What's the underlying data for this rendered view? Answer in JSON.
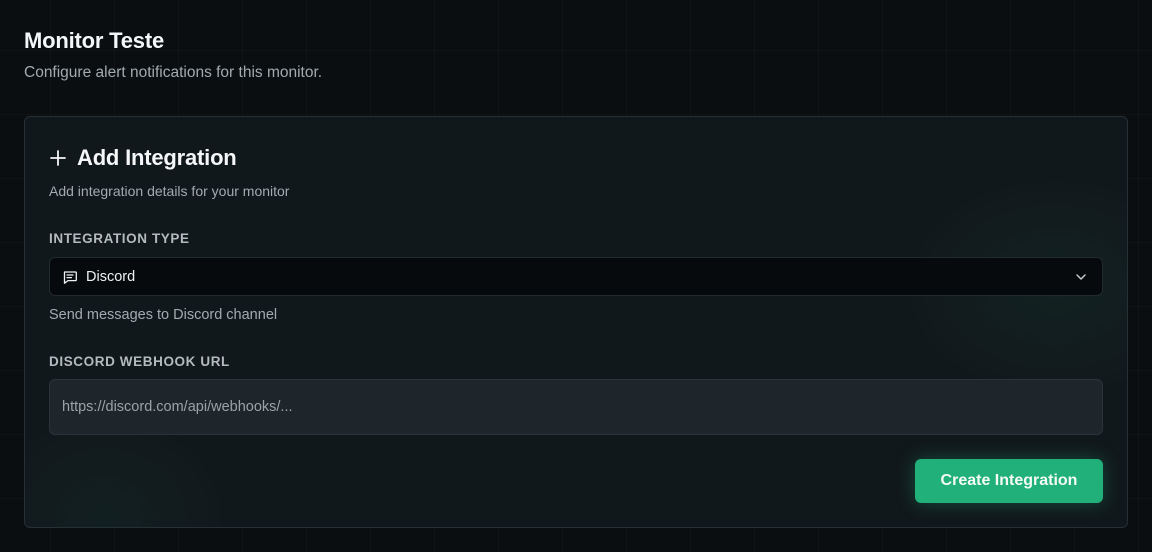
{
  "page": {
    "title": "Monitor Teste",
    "subtitle": "Configure alert notifications for this monitor."
  },
  "card": {
    "title": "Add Integration",
    "description": "Add integration details for your monitor",
    "integration_type": {
      "label": "INTEGRATION TYPE",
      "selected": "Discord",
      "icon": "message-square-icon",
      "helper": "Send messages to Discord channel"
    },
    "webhook": {
      "label": "DISCORD WEBHOOK URL",
      "value": "",
      "placeholder": "https://discord.com/api/webhooks/..."
    },
    "submit_label": "Create Integration"
  },
  "colors": {
    "accent": "#22b07a",
    "background": "#0a0e10",
    "card": "#11181c"
  }
}
